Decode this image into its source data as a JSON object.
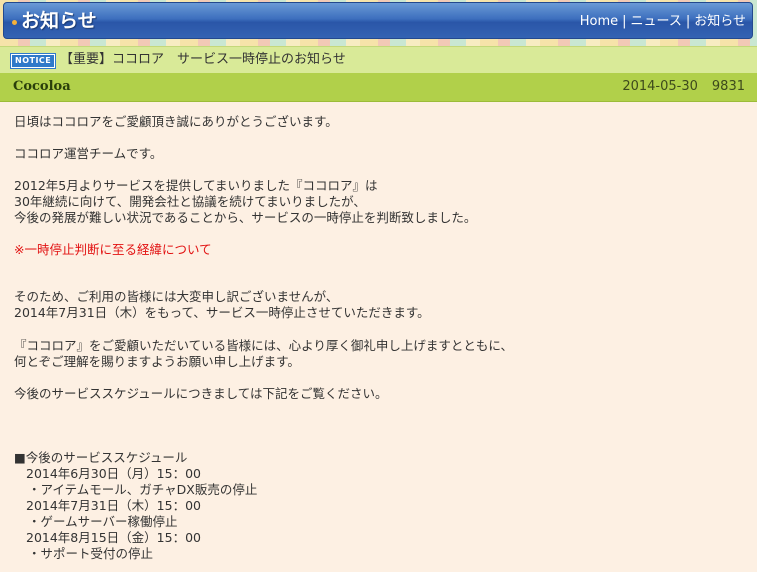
{
  "header": {
    "title": "お知らせ",
    "nav": [
      "Home",
      "ニュース",
      "お知らせ"
    ],
    "nav_separator": "|"
  },
  "notice": {
    "badge": "NOTICE",
    "title": "【重要】ココロア　サービス一時停止のお知らせ"
  },
  "meta": {
    "author": "Cocoloa",
    "date": "2014-05-30",
    "views": "9831"
  },
  "body": {
    "l1": "日頃はココロアをご愛顧頂き誠にありがとうございます。",
    "l2": "ココロア運営チームです。",
    "l3": "2012年5月よりサービスを提供してまいりました『ココロア』は",
    "l4": "30年継続に向けて、開発会社と協議を続けてまいりましたが、",
    "l5": "今後の発展が難しい状況であることから、サービスの一時停止を判断致しました。",
    "link": "※一時停止判断に至る経緯について",
    "l6": "そのため、ご利用の皆様には大変申し訳ございませんが、",
    "l7": "2014年7月31日（木）をもって、サービス一時停止させていただきます。",
    "l8": "『ココロア』をご愛顧いただいている皆様には、心より厚く御礼申し上げますとともに、",
    "l9": "何とぞご理解を賜りますようお願い申し上げます。",
    "l10": "今後のサービススケジュールにつきましては下記をご覧ください。",
    "schedule_heading": "■今後のサービススケジュール",
    "schedule": [
      {
        "date": "2014年6月30日（月）15：00",
        "item": "・アイテムモール、ガチャDX販売の停止"
      },
      {
        "date": "2014年7月31日（木）15：00",
        "item": "・ゲームサーバー稼働停止"
      },
      {
        "date": "2014年8月15日（金）15：00",
        "item": "・サポート受付の停止"
      }
    ]
  }
}
